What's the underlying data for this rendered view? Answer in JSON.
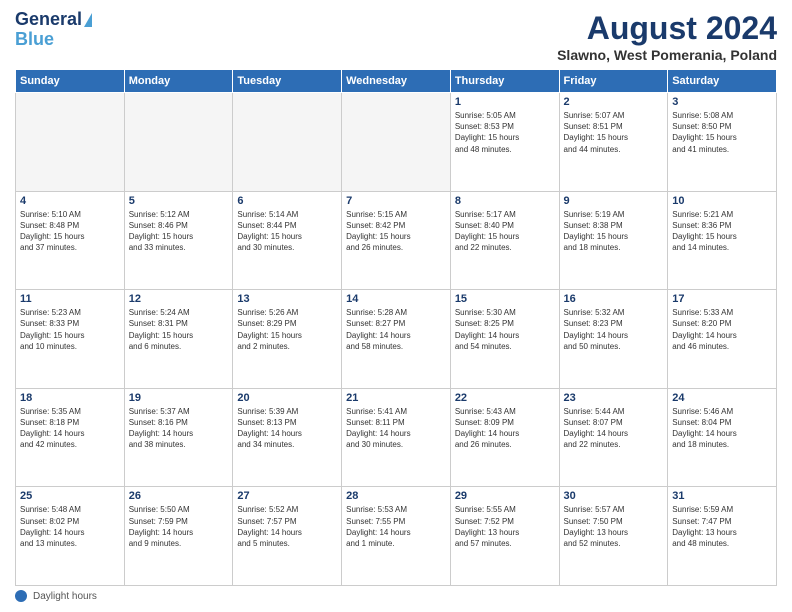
{
  "logo": {
    "line1": "General",
    "line2": "Blue"
  },
  "title": "August 2024",
  "subtitle": "Slawno, West Pomerania, Poland",
  "weekdays": [
    "Sunday",
    "Monday",
    "Tuesday",
    "Wednesday",
    "Thursday",
    "Friday",
    "Saturday"
  ],
  "footer": {
    "label": "Daylight hours"
  },
  "weeks": [
    [
      {
        "day": "",
        "info": ""
      },
      {
        "day": "",
        "info": ""
      },
      {
        "day": "",
        "info": ""
      },
      {
        "day": "",
        "info": ""
      },
      {
        "day": "1",
        "info": "Sunrise: 5:05 AM\nSunset: 8:53 PM\nDaylight: 15 hours\nand 48 minutes."
      },
      {
        "day": "2",
        "info": "Sunrise: 5:07 AM\nSunset: 8:51 PM\nDaylight: 15 hours\nand 44 minutes."
      },
      {
        "day": "3",
        "info": "Sunrise: 5:08 AM\nSunset: 8:50 PM\nDaylight: 15 hours\nand 41 minutes."
      }
    ],
    [
      {
        "day": "4",
        "info": "Sunrise: 5:10 AM\nSunset: 8:48 PM\nDaylight: 15 hours\nand 37 minutes."
      },
      {
        "day": "5",
        "info": "Sunrise: 5:12 AM\nSunset: 8:46 PM\nDaylight: 15 hours\nand 33 minutes."
      },
      {
        "day": "6",
        "info": "Sunrise: 5:14 AM\nSunset: 8:44 PM\nDaylight: 15 hours\nand 30 minutes."
      },
      {
        "day": "7",
        "info": "Sunrise: 5:15 AM\nSunset: 8:42 PM\nDaylight: 15 hours\nand 26 minutes."
      },
      {
        "day": "8",
        "info": "Sunrise: 5:17 AM\nSunset: 8:40 PM\nDaylight: 15 hours\nand 22 minutes."
      },
      {
        "day": "9",
        "info": "Sunrise: 5:19 AM\nSunset: 8:38 PM\nDaylight: 15 hours\nand 18 minutes."
      },
      {
        "day": "10",
        "info": "Sunrise: 5:21 AM\nSunset: 8:36 PM\nDaylight: 15 hours\nand 14 minutes."
      }
    ],
    [
      {
        "day": "11",
        "info": "Sunrise: 5:23 AM\nSunset: 8:33 PM\nDaylight: 15 hours\nand 10 minutes."
      },
      {
        "day": "12",
        "info": "Sunrise: 5:24 AM\nSunset: 8:31 PM\nDaylight: 15 hours\nand 6 minutes."
      },
      {
        "day": "13",
        "info": "Sunrise: 5:26 AM\nSunset: 8:29 PM\nDaylight: 15 hours\nand 2 minutes."
      },
      {
        "day": "14",
        "info": "Sunrise: 5:28 AM\nSunset: 8:27 PM\nDaylight: 14 hours\nand 58 minutes."
      },
      {
        "day": "15",
        "info": "Sunrise: 5:30 AM\nSunset: 8:25 PM\nDaylight: 14 hours\nand 54 minutes."
      },
      {
        "day": "16",
        "info": "Sunrise: 5:32 AM\nSunset: 8:23 PM\nDaylight: 14 hours\nand 50 minutes."
      },
      {
        "day": "17",
        "info": "Sunrise: 5:33 AM\nSunset: 8:20 PM\nDaylight: 14 hours\nand 46 minutes."
      }
    ],
    [
      {
        "day": "18",
        "info": "Sunrise: 5:35 AM\nSunset: 8:18 PM\nDaylight: 14 hours\nand 42 minutes."
      },
      {
        "day": "19",
        "info": "Sunrise: 5:37 AM\nSunset: 8:16 PM\nDaylight: 14 hours\nand 38 minutes."
      },
      {
        "day": "20",
        "info": "Sunrise: 5:39 AM\nSunset: 8:13 PM\nDaylight: 14 hours\nand 34 minutes."
      },
      {
        "day": "21",
        "info": "Sunrise: 5:41 AM\nSunset: 8:11 PM\nDaylight: 14 hours\nand 30 minutes."
      },
      {
        "day": "22",
        "info": "Sunrise: 5:43 AM\nSunset: 8:09 PM\nDaylight: 14 hours\nand 26 minutes."
      },
      {
        "day": "23",
        "info": "Sunrise: 5:44 AM\nSunset: 8:07 PM\nDaylight: 14 hours\nand 22 minutes."
      },
      {
        "day": "24",
        "info": "Sunrise: 5:46 AM\nSunset: 8:04 PM\nDaylight: 14 hours\nand 18 minutes."
      }
    ],
    [
      {
        "day": "25",
        "info": "Sunrise: 5:48 AM\nSunset: 8:02 PM\nDaylight: 14 hours\nand 13 minutes."
      },
      {
        "day": "26",
        "info": "Sunrise: 5:50 AM\nSunset: 7:59 PM\nDaylight: 14 hours\nand 9 minutes."
      },
      {
        "day": "27",
        "info": "Sunrise: 5:52 AM\nSunset: 7:57 PM\nDaylight: 14 hours\nand 5 minutes."
      },
      {
        "day": "28",
        "info": "Sunrise: 5:53 AM\nSunset: 7:55 PM\nDaylight: 14 hours\nand 1 minute."
      },
      {
        "day": "29",
        "info": "Sunrise: 5:55 AM\nSunset: 7:52 PM\nDaylight: 13 hours\nand 57 minutes."
      },
      {
        "day": "30",
        "info": "Sunrise: 5:57 AM\nSunset: 7:50 PM\nDaylight: 13 hours\nand 52 minutes."
      },
      {
        "day": "31",
        "info": "Sunrise: 5:59 AM\nSunset: 7:47 PM\nDaylight: 13 hours\nand 48 minutes."
      }
    ]
  ]
}
